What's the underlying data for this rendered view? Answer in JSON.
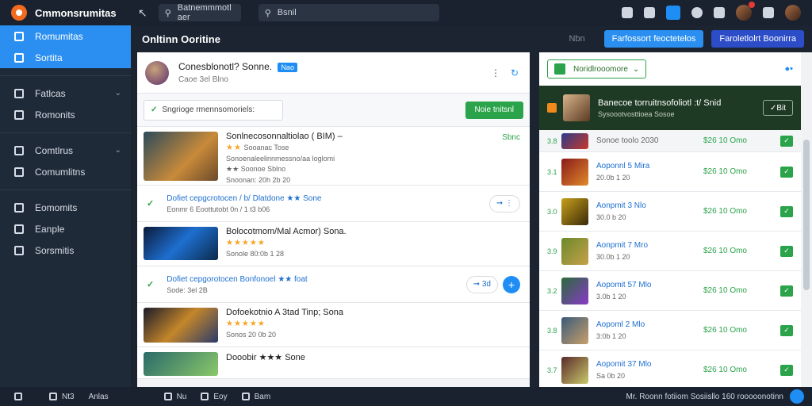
{
  "topbar": {
    "app_title": "Cmmonsrumitas",
    "search_left": "Batnemmmotl aer",
    "search_right": "Bsnil"
  },
  "sidebar": {
    "items": [
      {
        "label": "Romumitas",
        "active": true
      },
      {
        "label": "Sortita",
        "active": true
      },
      {
        "label": "Fatlcas",
        "chevron": true
      },
      {
        "label": "Romonits"
      },
      {
        "label": "Comtlrus",
        "chevron": true
      },
      {
        "label": "Comumlitns"
      },
      {
        "label": "Eomomits"
      },
      {
        "label": "Eanple"
      },
      {
        "label": "Sorsmitis"
      }
    ]
  },
  "main": {
    "title": "Onltinn Ooritine",
    "muted": "Nbn",
    "btn_blue": "Farfossort feoctetelos",
    "btn_navy": "Faroletlolrt Boonirra"
  },
  "profile": {
    "name": "Conesblonotl? Sonne.",
    "chip": "Nao",
    "sub": "Caoe 3el Blno"
  },
  "status": {
    "box_text": "Sngrioge rmennsomoriels:",
    "green_btn": "Noie tnitsnl"
  },
  "games": [
    {
      "title": "Sonlnecosonnaltiolao ( BIM) –",
      "stars": "★★",
      "line1": "Sooanac Tose",
      "line2": "Sonoenaleelinnmessno/aa loglomi",
      "line3": "★★ Soonoe Sblno",
      "meta": "Snoonan: 20h 2b 20",
      "price": "Sbnc"
    },
    {
      "title": "Bolocotmom/Mal Acmor) Sona.",
      "stars": "★★★★★",
      "meta": "Sonole 80:0b 1 28"
    },
    {
      "title": "Dofoekotnio A 3tad Tinp; Sona",
      "stars": "★★★★★",
      "meta": "Sonos 20 0b 20"
    },
    {
      "title": "Dooobir ★★★ Sone",
      "stars": "",
      "meta": ""
    }
  ],
  "deals": [
    {
      "title": "Dofiet cepgcrotocen / b/ Dlatdone ★★ Sone",
      "sub": "Eonmr 6 Eoottutobt 0n / 1 t3 b06"
    },
    {
      "title": "Dofiet cepgorotocen Bonfonoel ★★ foat",
      "sub": "Sode: 3el 2B",
      "pill": "3d"
    }
  ],
  "right": {
    "top_btn": "Noridlrooomore",
    "featured": {
      "title": "Banecoe torruitnsofoliotl :t/ Snid",
      "sub": "Sysoootvosttioea Sosoe"
    },
    "featured_btn": "Bit",
    "rows": [
      {
        "num": "3.8",
        "title": "Sonoe toolo 2030",
        "sub": "",
        "price": "$26 10 Omo"
      },
      {
        "num": "3.1",
        "title": "Aoponnl 5 Mira",
        "sub": "20.0b 1 20",
        "price": "$26 10 Omo"
      },
      {
        "num": "3.0",
        "title": "Aonpmit 3 Nlo",
        "sub": "30.0 b 20",
        "price": "$26 10 Omo"
      },
      {
        "num": "3.9",
        "title": "Aonpmit 7 Mro",
        "sub": "30.0b 1 20",
        "price": "$26 10 Omo"
      },
      {
        "num": "3.2",
        "title": "Aopomit 57 Mlo",
        "sub": "3.0b 1 20",
        "price": "$26 10 Omo"
      },
      {
        "num": "3.8",
        "title": "Aopoml 2 Mlo",
        "sub": "3:0b 1 20",
        "price": "$26 10 Omo"
      },
      {
        "num": "3.7",
        "title": "Aopomit 37 Mlo",
        "sub": "Sa 0b 20",
        "price": "$26 10 Omo"
      }
    ]
  },
  "bottom": {
    "items": [
      "Nt3",
      "Anlas",
      "Nu",
      "Eoy",
      "Bam"
    ],
    "status": "Mr. Roonn fotiiom Sosiisllo 160 rooooonotinn"
  }
}
